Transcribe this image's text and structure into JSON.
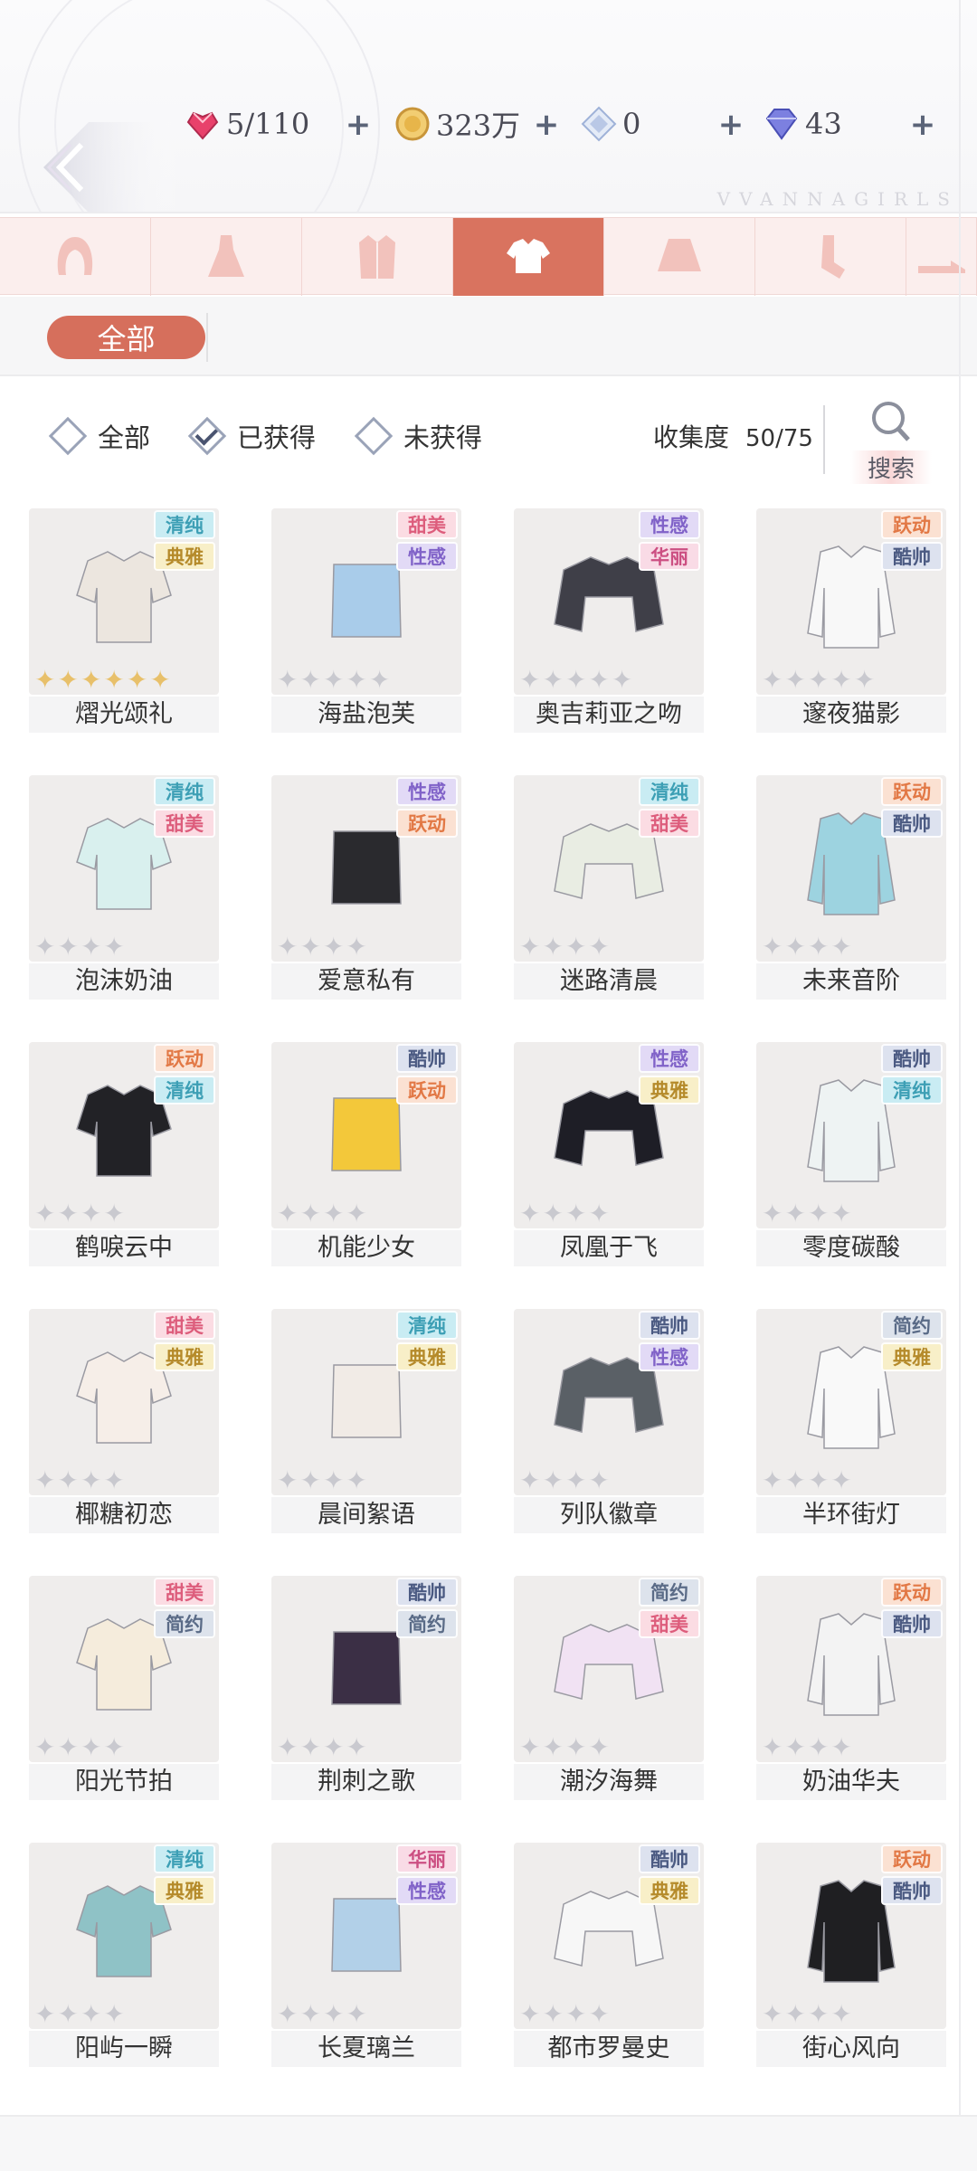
{
  "resources": [
    {
      "icon": "heart-gem-icon",
      "value": "5/110",
      "color": "#e8416b"
    },
    {
      "icon": "gold-coin-icon",
      "value": "323万",
      "color": "#e7b54a"
    },
    {
      "icon": "crystal-icon",
      "value": "0",
      "color": "#9fb2d8"
    },
    {
      "icon": "diamond-icon",
      "value": "43",
      "color": "#6a6fd8"
    }
  ],
  "brand_watermark": "VVANNAGIRLS",
  "category_tabs": [
    {
      "icon": "hair-icon",
      "active": false
    },
    {
      "icon": "dress-icon",
      "active": false
    },
    {
      "icon": "coat-icon",
      "active": false
    },
    {
      "icon": "top-icon",
      "active": true
    },
    {
      "icon": "skirt-icon",
      "active": false
    },
    {
      "icon": "socks-icon",
      "active": false
    },
    {
      "icon": "shoes-icon",
      "active": false
    }
  ],
  "subcategory_pill": "全部",
  "filters": [
    {
      "label": "全部",
      "checked": false
    },
    {
      "label": "已获得",
      "checked": true
    },
    {
      "label": "未获得",
      "checked": false
    }
  ],
  "collection": {
    "label": "收集度",
    "value": "50/75"
  },
  "search_label": "搜索",
  "tag_colors": {
    "清纯": {
      "bg": "#c9ecf3",
      "fg": "#3d9fb5"
    },
    "典雅": {
      "bg": "#f8efc8",
      "fg": "#b58a2a"
    },
    "甜美": {
      "bg": "#fbdce3",
      "fg": "#dd5d7c"
    },
    "性感": {
      "bg": "#e2daf6",
      "fg": "#8062c8"
    },
    "华丽": {
      "bg": "#f9dbe6",
      "fg": "#cc4f82"
    },
    "跃动": {
      "bg": "#fbe1d2",
      "fg": "#e27845"
    },
    "酷帅": {
      "bg": "#dde2ef",
      "fg": "#4b5a82"
    },
    "简约": {
      "bg": "#dde3ec",
      "fg": "#5a6b87"
    }
  },
  "items": [
    {
      "name": "熠光颂礼",
      "tags": [
        "清纯",
        "典雅"
      ],
      "stars": 6,
      "gold": true,
      "color": "#ece6df"
    },
    {
      "name": "海盐泡芙",
      "tags": [
        "甜美",
        "性感"
      ],
      "stars": 5,
      "gold": false,
      "color": "#a9ccea"
    },
    {
      "name": "奥吉莉亚之吻",
      "tags": [
        "性感",
        "华丽"
      ],
      "stars": 5,
      "gold": false,
      "color": "#3f3f48"
    },
    {
      "name": "邃夜猫影",
      "tags": [
        "跃动",
        "酷帅"
      ],
      "stars": 5,
      "gold": false,
      "color": "#f8f8f8"
    },
    {
      "name": "泡沫奶油",
      "tags": [
        "清纯",
        "甜美"
      ],
      "stars": 4,
      "gold": false,
      "color": "#d9f0ee"
    },
    {
      "name": "爱意私有",
      "tags": [
        "性感",
        "跃动"
      ],
      "stars": 4,
      "gold": false,
      "color": "#2a2a2e"
    },
    {
      "name": "迷路清晨",
      "tags": [
        "清纯",
        "甜美"
      ],
      "stars": 4,
      "gold": false,
      "color": "#e9ede3"
    },
    {
      "name": "未来音阶",
      "tags": [
        "跃动",
        "酷帅"
      ],
      "stars": 4,
      "gold": false,
      "color": "#9dd3e0"
    },
    {
      "name": "鹤唳云中",
      "tags": [
        "跃动",
        "清纯"
      ],
      "stars": 4,
      "gold": false,
      "color": "#222226"
    },
    {
      "name": "机能少女",
      "tags": [
        "酷帅",
        "跃动"
      ],
      "stars": 4,
      "gold": false,
      "color": "#f3c83a"
    },
    {
      "name": "凤凰于飞",
      "tags": [
        "性感",
        "典雅"
      ],
      "stars": 4,
      "gold": false,
      "color": "#1e1e26"
    },
    {
      "name": "零度碳酸",
      "tags": [
        "酷帅",
        "清纯"
      ],
      "stars": 4,
      "gold": false,
      "color": "#eef3f3"
    },
    {
      "name": "椰糖初恋",
      "tags": [
        "甜美",
        "典雅"
      ],
      "stars": 4,
      "gold": false,
      "color": "#f6eee8"
    },
    {
      "name": "晨间絮语",
      "tags": [
        "清纯",
        "典雅"
      ],
      "stars": 4,
      "gold": false,
      "color": "#f1ebe6"
    },
    {
      "name": "列队徽章",
      "tags": [
        "酷帅",
        "性感"
      ],
      "stars": 4,
      "gold": false,
      "color": "#5a6066"
    },
    {
      "name": "半环街灯",
      "tags": [
        "简约",
        "典雅"
      ],
      "stars": 4,
      "gold": false,
      "color": "#f9f9f9"
    },
    {
      "name": "阳光节拍",
      "tags": [
        "甜美",
        "简约"
      ],
      "stars": 4,
      "gold": false,
      "color": "#f5ecdc"
    },
    {
      "name": "荆刺之歌",
      "tags": [
        "酷帅",
        "简约"
      ],
      "stars": 4,
      "gold": false,
      "color": "#3b2f45"
    },
    {
      "name": "潮汐海舞",
      "tags": [
        "简约",
        "甜美"
      ],
      "stars": 4,
      "gold": false,
      "color": "#f1e2f3"
    },
    {
      "name": "奶油华夫",
      "tags": [
        "跃动",
        "酷帅"
      ],
      "stars": 4,
      "gold": false,
      "color": "#f3f3f3"
    },
    {
      "name": "阳屿一瞬",
      "tags": [
        "清纯",
        "典雅"
      ],
      "stars": 4,
      "gold": false,
      "color": "#8fc2c6"
    },
    {
      "name": "长夏璃兰",
      "tags": [
        "华丽",
        "性感"
      ],
      "stars": 4,
      "gold": false,
      "color": "#b2d0e8"
    },
    {
      "name": "都市罗曼史",
      "tags": [
        "酷帅",
        "典雅"
      ],
      "stars": 4,
      "gold": false,
      "color": "#f7f7f7"
    },
    {
      "name": "街心风向",
      "tags": [
        "跃动",
        "酷帅"
      ],
      "stars": 4,
      "gold": false,
      "color": "#1f1f22"
    }
  ]
}
